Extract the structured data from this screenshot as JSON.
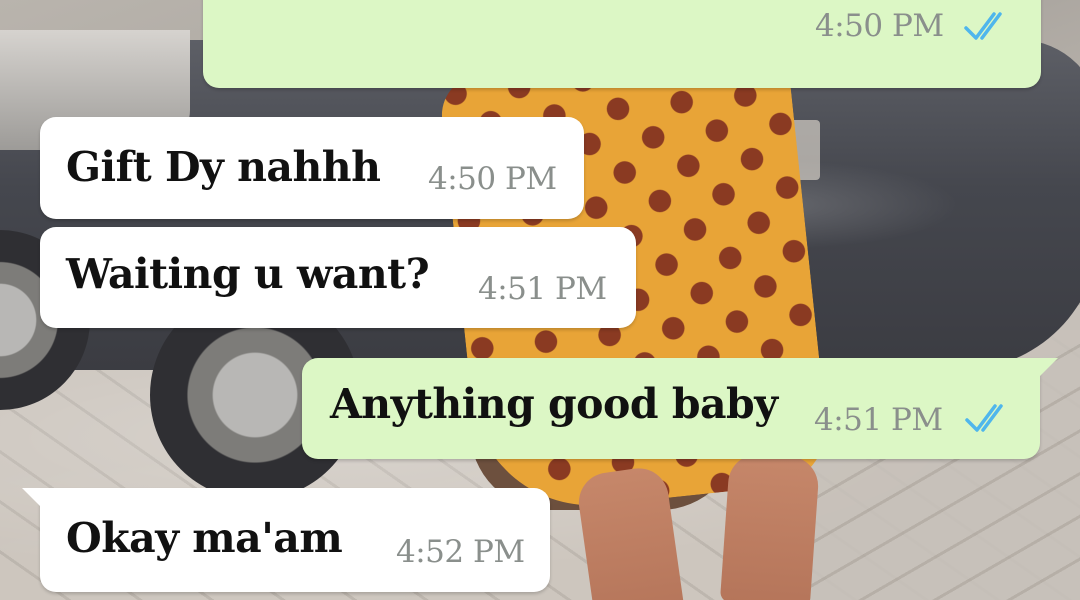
{
  "colors": {
    "incoming_bubble": "#ffffff",
    "outgoing_bubble": "#dcf7c5",
    "timestamp": "#8a8f8c",
    "read_ticks": "#4fb6ec",
    "message_text": "#111111"
  },
  "messages": [
    {
      "direction": "outgoing",
      "text": "",
      "time": "4:50 PM",
      "status": "read",
      "status_icon": "double-check-icon"
    },
    {
      "direction": "incoming",
      "text": "Gift Dy nahhh",
      "time": "4:50 PM"
    },
    {
      "direction": "incoming",
      "text": "Waiting u want?",
      "time": "4:51 PM"
    },
    {
      "direction": "outgoing",
      "text": "Anything good baby",
      "time": "4:51 PM",
      "status": "read",
      "status_icon": "double-check-icon"
    },
    {
      "direction": "incoming",
      "text": "Okay ma'am",
      "time": "4:52 PM"
    }
  ]
}
